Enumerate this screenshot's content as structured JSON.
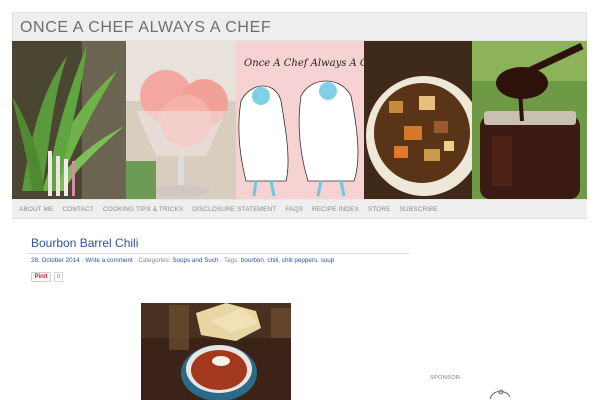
{
  "site": {
    "title": "ONCE A CHEF ALWAYS A CHEF"
  },
  "banner": {
    "logo_text": "Once A Chef Always A Chef",
    "panels": [
      "ramps-photo",
      "sorbet-photo",
      "chefs-illustration",
      "stew-photo",
      "chocolate-sauce-photo"
    ]
  },
  "nav": {
    "items": [
      "ABOUT ME",
      "CONTACT",
      "COOKING TIPS & TRICKS",
      "DISCLOSURE STATEMENT",
      "FAQS",
      "RECIPE INDEX",
      "STORE",
      "SUBSCRIBE"
    ]
  },
  "post": {
    "title": "Bourbon Barrel Chili",
    "date": "28. October 2014",
    "sep1": " · ",
    "comment_link": "Write a comment",
    "categories_label": " · Categories: ",
    "category": "Soups and Such",
    "tags_label": " · Tags: ",
    "tags": [
      "bourbon",
      "chili",
      "chili peppers",
      "soup"
    ]
  },
  "share": {
    "pin_label": "Pinit",
    "pin_count": "0"
  },
  "sidebar": {
    "sponsor_label": "SPONSOR"
  },
  "colors": {
    "link": "#2a55a3",
    "nav_bg": "#efefef",
    "header_bg": "#eeeeee"
  }
}
